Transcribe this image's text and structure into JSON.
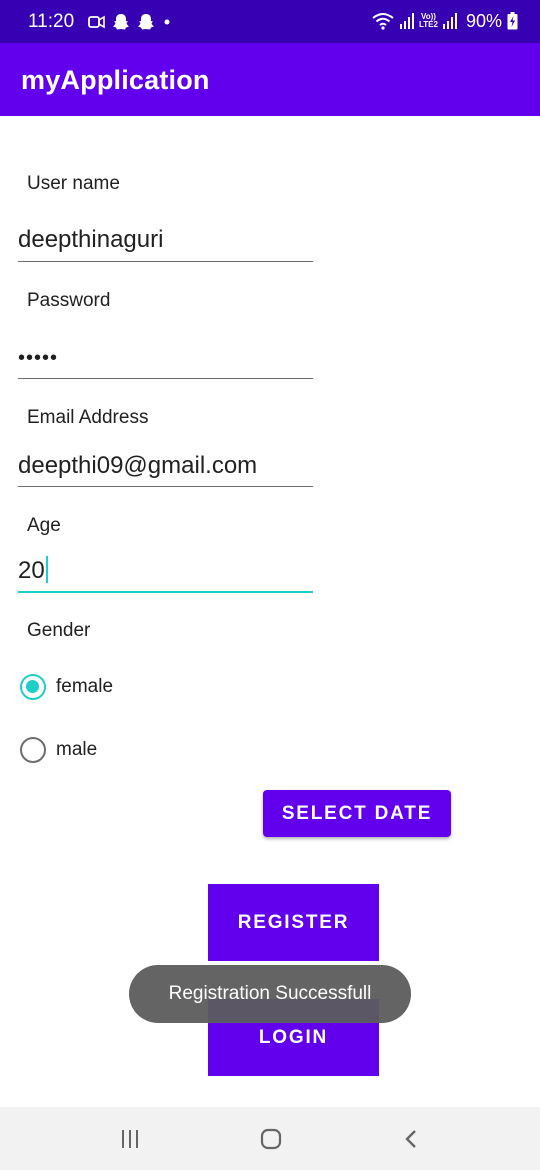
{
  "status_bar": {
    "time": "11:20",
    "battery": "90%",
    "network": "LTE2",
    "network_top": "Vo))",
    "left_icons": [
      "video-camera-icon",
      "snapchat-icon",
      "snapchat-icon",
      "dot-icon"
    ],
    "right_icons": [
      "wifi-icon",
      "signal-icon",
      "lte-icon",
      "signal-icon",
      "battery-charging-icon"
    ]
  },
  "app_bar": {
    "title": "myApplication"
  },
  "form": {
    "username": {
      "label": "User name",
      "value": "deepthinaguri"
    },
    "password": {
      "label": "Password",
      "value": "•••••"
    },
    "email": {
      "label": "Email Address",
      "value": "deepthi09@gmail.com"
    },
    "age": {
      "label": "Age",
      "value": "20"
    },
    "gender": {
      "label": "Gender",
      "options": [
        {
          "label": "female",
          "checked": true
        },
        {
          "label": "male",
          "checked": false
        }
      ]
    }
  },
  "buttons": {
    "select_date": "SELECT DATE",
    "register": "REGISTER",
    "login": "LOGIN"
  },
  "toast": {
    "message": "Registration Successfull"
  },
  "nav_bar": {
    "icons": [
      "recent-apps-icon",
      "home-icon",
      "back-icon"
    ]
  },
  "colors": {
    "status_bar": "#3700b3",
    "primary": "#6200ee",
    "accent": "#1dcfc6",
    "toast_bg": "#5c5c5c",
    "nav_bg": "#f2f2f2"
  }
}
